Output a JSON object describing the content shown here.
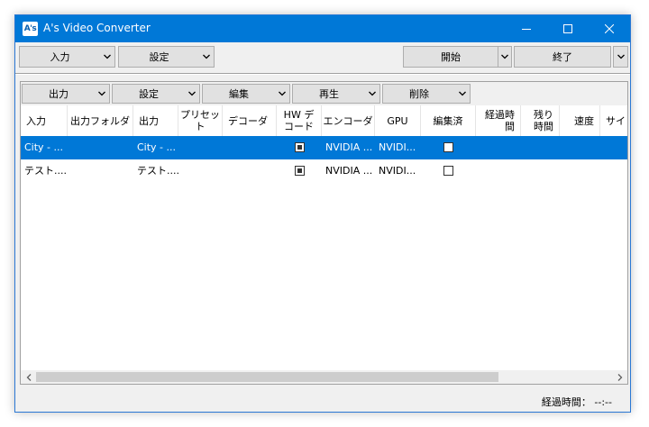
{
  "window": {
    "title": "A's Video Converter",
    "icon_text": "A's"
  },
  "toolbar_main": {
    "input_label": "入力",
    "settings_label": "設定",
    "start_label": "開始",
    "exit_label": "終了"
  },
  "toolbar_list": {
    "output_label": "出力",
    "settings_label": "設定",
    "edit_label": "編集",
    "play_label": "再生",
    "delete_label": "削除"
  },
  "columns": [
    "入力",
    "出力フォルダ",
    "出力",
    "プリセット",
    "デコーダ",
    "HW デ\nコード",
    "エンコーダ",
    "GPU",
    "編集済",
    "経過時\n間",
    "残り\n時間",
    "速度",
    "サイ"
  ],
  "rows": [
    {
      "input": "City - ...",
      "output": "City - ...",
      "hw_decode": true,
      "encoder": "NVIDIA ...",
      "gpu": "NVIDI...",
      "edited": false,
      "selected": true
    },
    {
      "input": "テスト....",
      "output": "テスト....",
      "hw_decode": true,
      "encoder": "NVIDIA ...",
      "gpu": "NVIDI...",
      "edited": false,
      "selected": false
    }
  ],
  "status": {
    "elapsed": "経過時間： --:--"
  },
  "colors": {
    "titlebar": "#0078d7",
    "selection": "#0078d7"
  }
}
